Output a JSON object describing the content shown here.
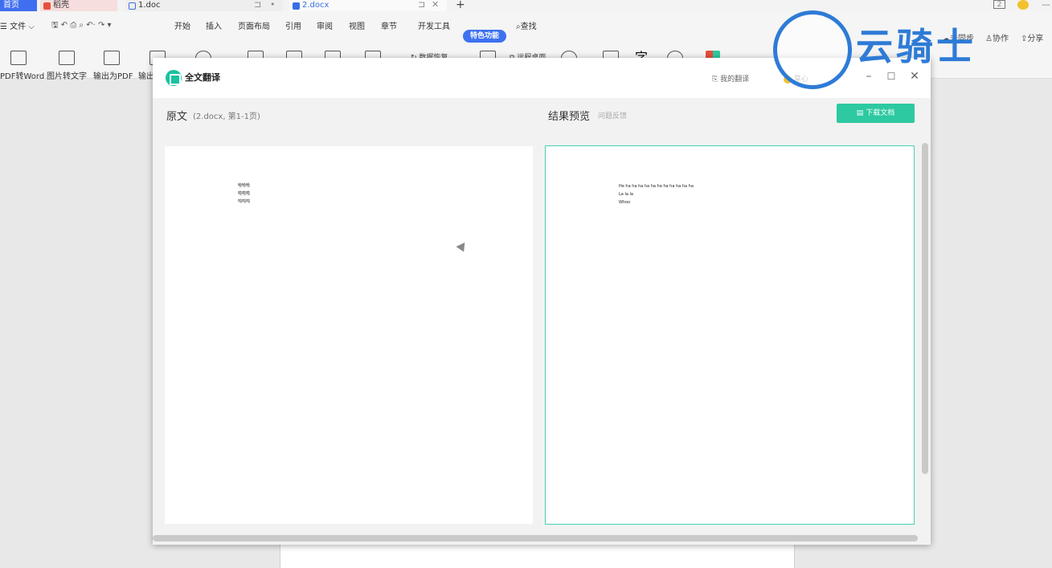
{
  "tabs": {
    "home": "首页",
    "daoke": "稻壳",
    "doc1": "1.doc",
    "doc2": "2.docx",
    "new_tab": "+"
  },
  "ribbon": {
    "file_menu": "文件",
    "menus": [
      "开始",
      "插入",
      "页面布局",
      "引用",
      "审阅",
      "视图",
      "章节",
      "开发工具"
    ],
    "special": "特色功能",
    "search": "查找",
    "sync": "未同步",
    "collab": "协作",
    "share": "分享",
    "tools": [
      "PDF转Word",
      "图片转文字",
      "输出为PDF",
      "输出"
    ],
    "data_recovery": "数据恢复",
    "remote_desktop": "远程桌面",
    "page_indicator": "2"
  },
  "watermark": {
    "text": "云骑士"
  },
  "dialog": {
    "title": "全文翻译",
    "my_translations": "我的翻译",
    "user": "草心",
    "original_label": "原文",
    "original_info": "(2.docx, 第1-1页)",
    "preview_label": "结果预览",
    "feedback": "问题反馈",
    "download": "下载文档",
    "original_lines": [
      "哈哈哈",
      "啦啦啦",
      "呜呜呜"
    ],
    "translated_lines": [
      "He ha ha ha ha ha ha ha ha ha ha ha",
      "La la la",
      "Whoo"
    ]
  },
  "colors": {
    "accent": "#3d71f0",
    "teal": "#2dc9a0",
    "watermark": "#2e7bd6"
  }
}
